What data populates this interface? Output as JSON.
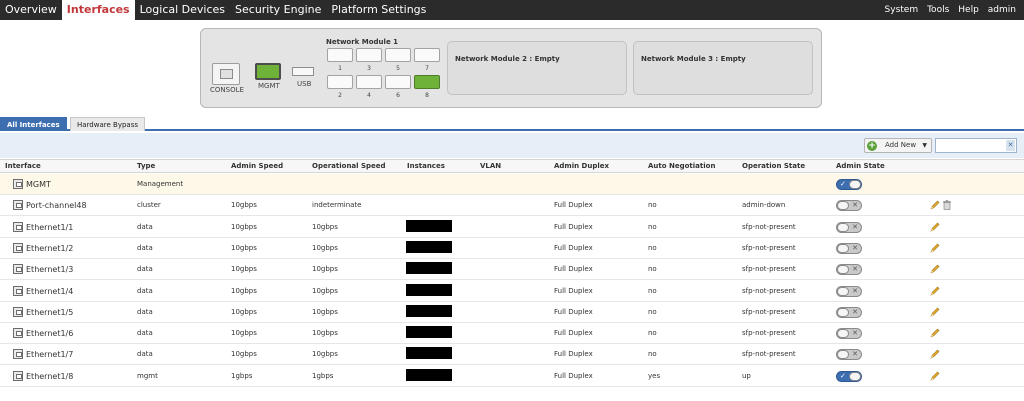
{
  "nav": {
    "tabs": [
      {
        "label": "Overview",
        "active": false
      },
      {
        "label": "Interfaces",
        "active": true
      },
      {
        "label": "Logical Devices",
        "active": false
      },
      {
        "label": "Security Engine",
        "active": false
      },
      {
        "label": "Platform Settings",
        "active": false
      }
    ],
    "right": [
      "System",
      "Tools",
      "Help",
      "admin"
    ]
  },
  "chassis": {
    "console_label": "CONSOLE",
    "mgmt_label": "MGMT",
    "usb_label": "USB",
    "network_module_1": {
      "title": "Network Module 1",
      "ports_top": [
        "1",
        "3",
        "5",
        "7"
      ],
      "ports_bottom": [
        "2",
        "4",
        "6",
        "8"
      ],
      "ports_up": [
        "8"
      ]
    },
    "network_module_2": "Network Module 2 : Empty",
    "network_module_3": "Network Module 3 : Empty"
  },
  "subtabs": [
    {
      "label": "All Interfaces",
      "active": true
    },
    {
      "label": "Hardware Bypass",
      "active": false
    }
  ],
  "toolbar": {
    "add_new_label": "Add New",
    "search_placeholder": "",
    "clear_symbol": "✕"
  },
  "table": {
    "columns": [
      "Interface",
      "Type",
      "Admin Speed",
      "Operational Speed",
      "Instances",
      "VLAN",
      "Admin Duplex",
      "Auto Negotiation",
      "Operation State",
      "Admin State"
    ],
    "rows": [
      {
        "interface": "MGMT",
        "type": "Management",
        "admin_speed": "",
        "oper_speed": "",
        "instances_redacted": false,
        "vlan": "",
        "admin_duplex": "",
        "auto_neg": "",
        "oper_state": "",
        "admin_state": "on",
        "edit": false,
        "delete": false
      },
      {
        "interface": "Port-channel48",
        "type": "cluster",
        "admin_speed": "10gbps",
        "oper_speed": "indeterminate",
        "instances_redacted": false,
        "vlan": "",
        "admin_duplex": "Full Duplex",
        "auto_neg": "no",
        "oper_state": "admin-down",
        "admin_state": "off",
        "edit": true,
        "delete": true
      },
      {
        "interface": "Ethernet1/1",
        "type": "data",
        "admin_speed": "10gbps",
        "oper_speed": "10gbps",
        "instances_redacted": true,
        "vlan": "",
        "admin_duplex": "Full Duplex",
        "auto_neg": "no",
        "oper_state": "sfp-not-present",
        "admin_state": "off",
        "edit": true,
        "delete": false
      },
      {
        "interface": "Ethernet1/2",
        "type": "data",
        "admin_speed": "10gbps",
        "oper_speed": "10gbps",
        "instances_redacted": true,
        "vlan": "",
        "admin_duplex": "Full Duplex",
        "auto_neg": "no",
        "oper_state": "sfp-not-present",
        "admin_state": "off",
        "edit": true,
        "delete": false
      },
      {
        "interface": "Ethernet1/3",
        "type": "data",
        "admin_speed": "10gbps",
        "oper_speed": "10gbps",
        "instances_redacted": true,
        "vlan": "",
        "admin_duplex": "Full Duplex",
        "auto_neg": "no",
        "oper_state": "sfp-not-present",
        "admin_state": "off",
        "edit": true,
        "delete": false
      },
      {
        "interface": "Ethernet1/4",
        "type": "data",
        "admin_speed": "10gbps",
        "oper_speed": "10gbps",
        "instances_redacted": true,
        "vlan": "",
        "admin_duplex": "Full Duplex",
        "auto_neg": "no",
        "oper_state": "sfp-not-present",
        "admin_state": "off",
        "edit": true,
        "delete": false
      },
      {
        "interface": "Ethernet1/5",
        "type": "data",
        "admin_speed": "10gbps",
        "oper_speed": "10gbps",
        "instances_redacted": true,
        "vlan": "",
        "admin_duplex": "Full Duplex",
        "auto_neg": "no",
        "oper_state": "sfp-not-present",
        "admin_state": "off",
        "edit": true,
        "delete": false
      },
      {
        "interface": "Ethernet1/6",
        "type": "data",
        "admin_speed": "10gbps",
        "oper_speed": "10gbps",
        "instances_redacted": true,
        "vlan": "",
        "admin_duplex": "Full Duplex",
        "auto_neg": "no",
        "oper_state": "sfp-not-present",
        "admin_state": "off",
        "edit": true,
        "delete": false
      },
      {
        "interface": "Ethernet1/7",
        "type": "data",
        "admin_speed": "10gbps",
        "oper_speed": "10gbps",
        "instances_redacted": true,
        "vlan": "",
        "admin_duplex": "Full Duplex",
        "auto_neg": "no",
        "oper_state": "sfp-not-present",
        "admin_state": "off",
        "edit": true,
        "delete": false
      },
      {
        "interface": "Ethernet1/8",
        "type": "mgmt",
        "admin_speed": "1gbps",
        "oper_speed": "1gbps",
        "instances_redacted": true,
        "vlan": "",
        "admin_duplex": "Full Duplex",
        "auto_neg": "yes",
        "oper_state": "up",
        "admin_state": "on",
        "edit": true,
        "delete": false
      }
    ]
  },
  "colors": {
    "accent": "#3d6fb0",
    "active_nav_text": "#c2383a",
    "port_up": "#6fb23a",
    "topbar": "#2b2b2b"
  }
}
